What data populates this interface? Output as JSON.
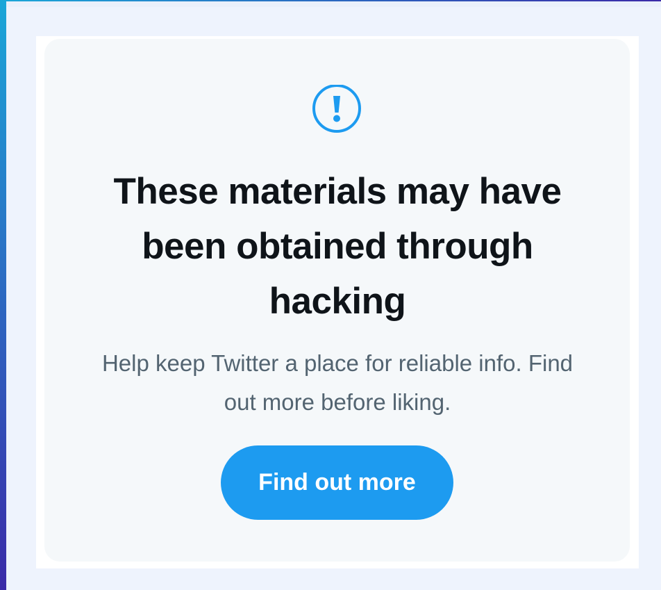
{
  "warning": {
    "icon": "alert-circle-icon",
    "headline": "These materials may have been obtained through hacking",
    "body": "Help keep Twitter a place for reliable info. Find out more before liking.",
    "button_label": "Find out more"
  },
  "colors": {
    "accent": "#1d9bf0",
    "headline_text": "#0f1419",
    "body_text": "#536471",
    "card_background": "#f5f8fa"
  }
}
